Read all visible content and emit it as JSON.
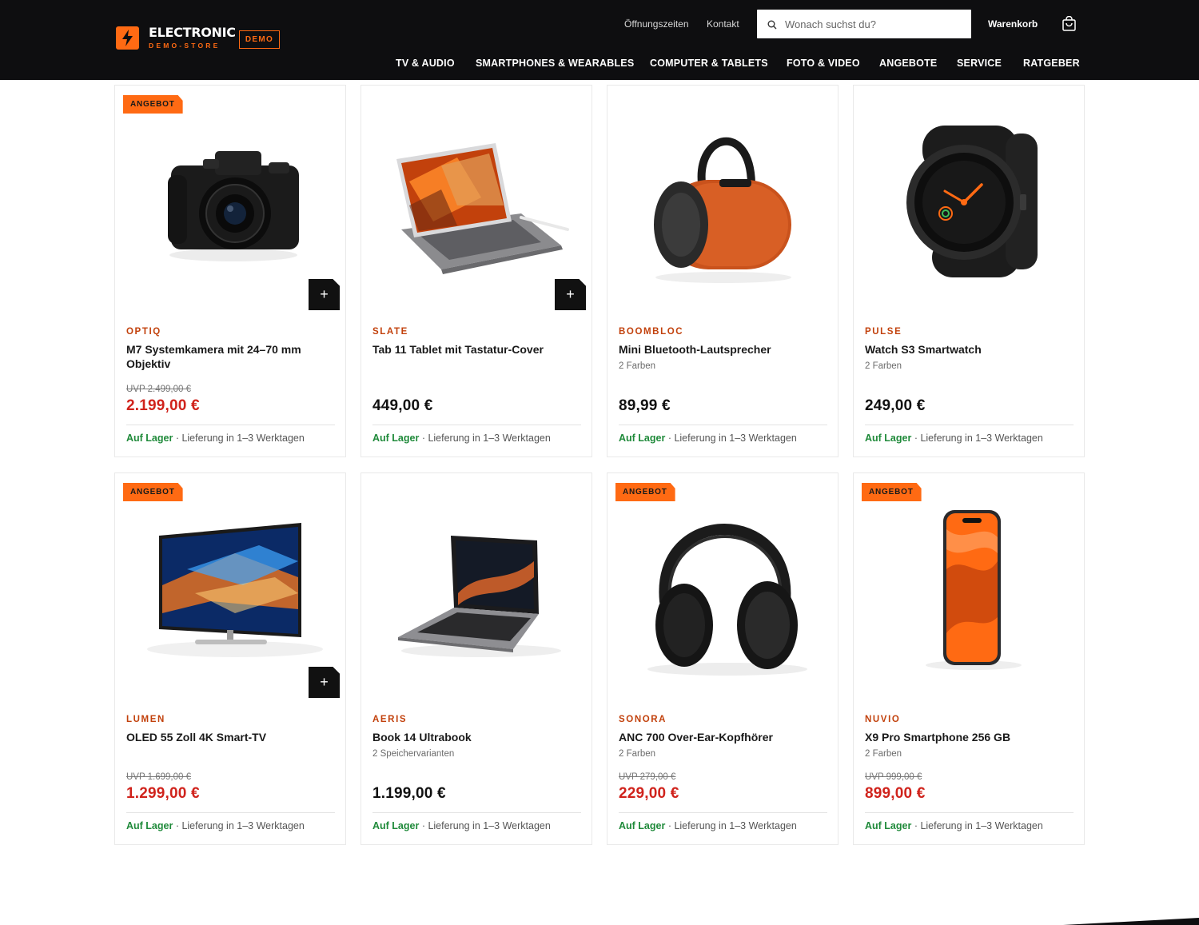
{
  "header": {
    "logo_title": "ELECTRONIC",
    "logo_subtitle": "DEMO-STORE",
    "logo_badge": "DEMO",
    "links": [
      "Öffnungszeiten",
      "Kontakt"
    ],
    "search_placeholder": "Wonach suchst du?",
    "cart_label": "Warenkorb",
    "nav": [
      "TV & AUDIO",
      "SMARTPHONES & WEARABLES",
      "COMPUTER & TABLETS",
      "FOTO & VIDEO",
      "ANGEBOTE",
      "SERVICE",
      "RATGEBER"
    ]
  },
  "colors": {
    "accent": "#ff6a13",
    "sale": "#d0231c",
    "in_stock": "#1f8a3a",
    "header_bg": "#0e0e10"
  },
  "products": [
    {
      "badge": "ANGEBOT",
      "brand": "OPTIQ",
      "name": "M7 Systemkamera mit 24–70 mm Objektiv",
      "variant": "",
      "uvp": "UVP 2.499,00 €",
      "price": "2.199,00 €",
      "stock": "Auf Lager",
      "delivery": " · Lieferung in 1–3 Werktagen",
      "image": "camera-icon",
      "add_button": "+"
    },
    {
      "badge": "",
      "brand": "SLATE",
      "name": "Tab 11 Tablet mit Tastatur-Cover",
      "variant": "",
      "uvp": "",
      "price": "449,00 €",
      "stock": "Auf Lager",
      "delivery": " · Lieferung in 1–3 Werktagen",
      "image": "tablet-icon",
      "add_button": "+"
    },
    {
      "badge": "",
      "brand": "BOOMBLOC",
      "name": "Mini Bluetooth-Lautsprecher",
      "variant": "2 Farben",
      "uvp": "",
      "price": "89,99 €",
      "stock": "Auf Lager",
      "delivery": " · Lieferung in 1–3 Werktagen",
      "image": "speaker-icon",
      "add_button": ""
    },
    {
      "badge": "",
      "brand": "PULSE",
      "name": "Watch S3 Smartwatch",
      "variant": "2 Farben",
      "uvp": "",
      "price": "249,00 €",
      "stock": "Auf Lager",
      "delivery": " · Lieferung in 1–3 Werktagen",
      "image": "smartwatch-icon",
      "add_button": ""
    },
    {
      "badge": "ANGEBOT",
      "brand": "LUMEN",
      "name": "OLED 55 Zoll 4K Smart-TV",
      "variant": "",
      "uvp": "UVP 1.699,00 €",
      "price": "1.299,00 €",
      "stock": "Auf Lager",
      "delivery": " · Lieferung in 1–3 Werktagen",
      "image": "tv-icon",
      "add_button": "+"
    },
    {
      "badge": "",
      "brand": "AERIS",
      "name": "Book 14 Ultrabook",
      "variant": "2 Speichervarianten",
      "uvp": "",
      "price": "1.199,00 €",
      "stock": "Auf Lager",
      "delivery": " · Lieferung in 1–3 Werktagen",
      "image": "laptop-icon",
      "add_button": ""
    },
    {
      "badge": "ANGEBOT",
      "brand": "SONORA",
      "name": "ANC 700 Over-Ear-Kopfhörer",
      "variant": "2 Farben",
      "uvp": "UVP 279,00 €",
      "price": "229,00 €",
      "stock": "Auf Lager",
      "delivery": " · Lieferung in 1–3 Werktagen",
      "image": "headphones-icon",
      "add_button": ""
    },
    {
      "badge": "ANGEBOT",
      "brand": "NUVIO",
      "name": "X9 Pro Smartphone 256 GB",
      "variant": "2 Farben",
      "uvp": "UVP 999,00 €",
      "price": "899,00 €",
      "stock": "Auf Lager",
      "delivery": " · Lieferung in 1–3 Werktagen",
      "image": "smartphone-icon",
      "add_button": ""
    }
  ]
}
